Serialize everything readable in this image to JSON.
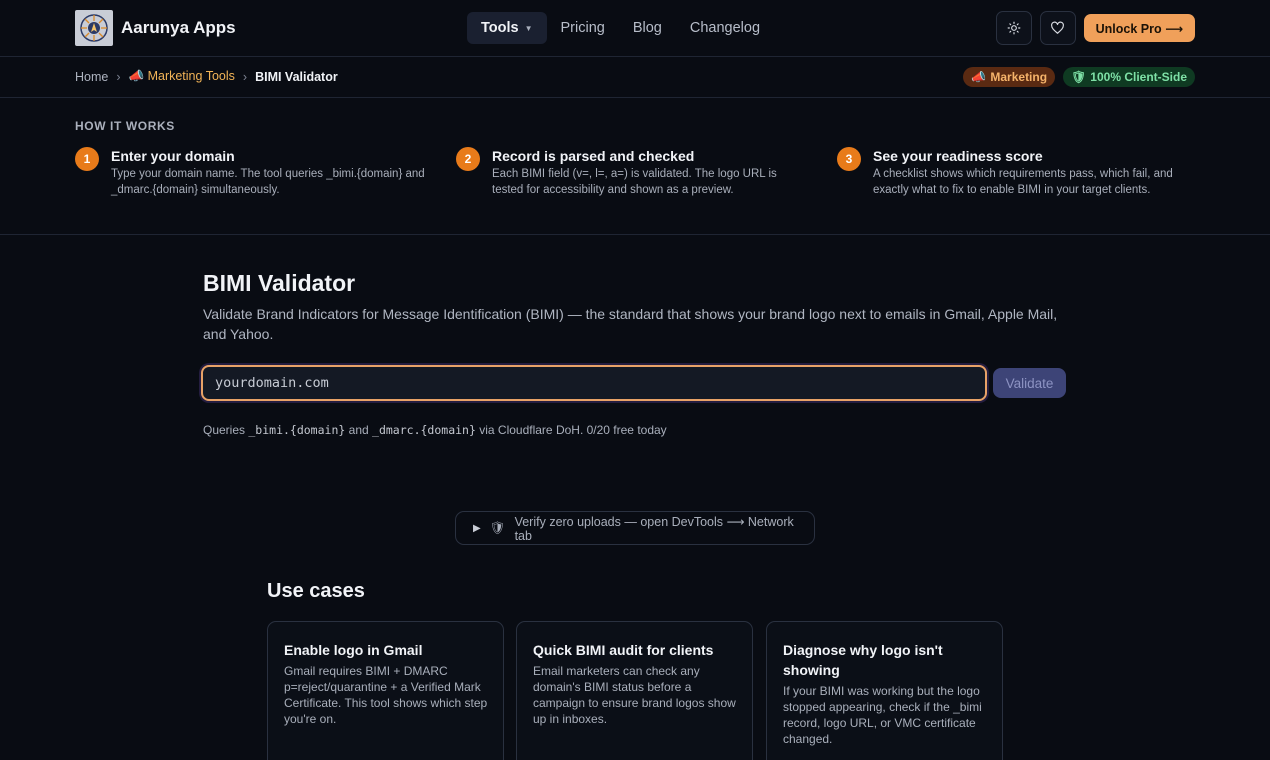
{
  "header": {
    "brand_name": "Aarunya Apps",
    "nav": [
      {
        "label": "Tools",
        "active": true
      },
      {
        "label": "Pricing"
      },
      {
        "label": "Blog"
      },
      {
        "label": "Changelog"
      }
    ],
    "unlock_label": "Unlock Pro ⟶"
  },
  "breadcrumb": {
    "home": "Home",
    "tools": "Marketing Tools",
    "current": "BIMI Validator"
  },
  "badges": {
    "marketing": "Marketing",
    "client_side": "100% Client-Side"
  },
  "how_it_works": {
    "title": "HOW IT WORKS",
    "steps": [
      {
        "num": "1",
        "title": "Enter your domain",
        "desc": "Type your domain name. The tool queries _bimi.{domain} and _dmarc.{domain} simultaneously."
      },
      {
        "num": "2",
        "title": "Record is parsed and checked",
        "desc": "Each BIMI field (v=, l=, a=) is validated. The logo URL is tested for accessibility and shown as a preview."
      },
      {
        "num": "3",
        "title": "See your readiness score",
        "desc": "A checklist shows which requirements pass, which fail, and exactly what to fix to enable BIMI in your target clients."
      }
    ]
  },
  "main": {
    "title": "BIMI Validator",
    "description": "Validate Brand Indicators for Message Identification (BIMI) — the standard that shows your brand logo next to emails in Gmail, Apple Mail, and Yahoo.",
    "input_placeholder": "yourdomain.com",
    "input_value": "",
    "validate_label": "Validate",
    "hint_prefix": "Queries",
    "hint_bimi": "_bimi.{domain}",
    "hint_and": "and",
    "hint_dmarc": "_dmarc.{domain}",
    "hint_suffix": "via Cloudflare DoH. 0/20 free today"
  },
  "verify": {
    "label": "Verify zero uploads — open DevTools ⟶ Network tab"
  },
  "use_cases": {
    "title": "Use cases",
    "cards": [
      {
        "title": "Enable logo in Gmail",
        "desc": "Gmail requires BIMI + DMARC p=reject/quarantine + a Verified Mark Certificate. This tool shows which step you're on."
      },
      {
        "title": "Quick BIMI audit for clients",
        "desc": "Email marketers can check any domain's BIMI status before a campaign to ensure brand logos show up in inboxes."
      },
      {
        "title": "Diagnose why logo isn't showing",
        "desc": "If your BIMI was working but the logo stopped appearing, check if the _bimi record, logo URL, or VMC certificate changed."
      }
    ]
  },
  "colors": {
    "accent_orange": "#e87b1a",
    "pro_button": "#f0a05a",
    "validate_disabled": "#3d4477",
    "background": "#090c13"
  },
  "icons": {
    "theme": "sun-icon",
    "favorite": "heart-icon",
    "marketing": "megaphone-icon",
    "client_side": "shield-icon",
    "verify": "shield-icon",
    "toggle": "play-icon"
  }
}
